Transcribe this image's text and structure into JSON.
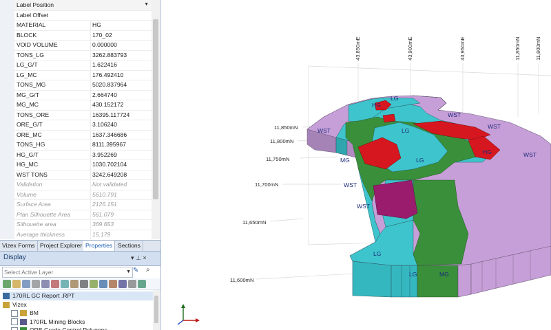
{
  "properties": {
    "rows": [
      {
        "key": "Label Position",
        "value": "",
        "has_dropdown": true,
        "selected": true
      },
      {
        "key": "Label Offset",
        "value": ""
      },
      {
        "key": "MATERIAL",
        "value": "HG"
      },
      {
        "key": "BLOCK",
        "value": "170_02"
      },
      {
        "key": "VOID VOLUME",
        "value": "0.000000"
      },
      {
        "key": "TONS_LG",
        "value": "3262.883793"
      },
      {
        "key": "LG_G/T",
        "value": "1.622416"
      },
      {
        "key": "LG_MC",
        "value": "176.492410"
      },
      {
        "key": "TONS_MG",
        "value": "5020.837964"
      },
      {
        "key": "MG_G/T",
        "value": "2.664740"
      },
      {
        "key": "MG_MC",
        "value": "430.152172"
      },
      {
        "key": "TONS_ORE",
        "value": "16395.117724"
      },
      {
        "key": "ORE_G/T",
        "value": "3.106240"
      },
      {
        "key": "ORE_MC",
        "value": "1637.346686"
      },
      {
        "key": "TONS_HG",
        "value": "8111.395967"
      },
      {
        "key": "HG_G/T",
        "value": "3.952269"
      },
      {
        "key": "HG_MC",
        "value": "1030.702104"
      },
      {
        "key": "WST TONS",
        "value": "3242.649208"
      },
      {
        "key": "Validation",
        "value": "Not validated",
        "disabled": true
      },
      {
        "key": "Volume",
        "value": "5610.791",
        "disabled": true
      },
      {
        "key": "Surface Area",
        "value": "2126.151",
        "disabled": true
      },
      {
        "key": "Plan Silhouette Area",
        "value": "561.079",
        "disabled": true
      },
      {
        "key": "Silhouette area",
        "value": "369.653",
        "disabled": true
      },
      {
        "key": "Average thickness",
        "value": "15.179",
        "disabled": true
      }
    ]
  },
  "tabs": [
    {
      "label": "Vizex Forms",
      "active": false
    },
    {
      "label": "Project Explorer",
      "active": false
    },
    {
      "label": "Properties",
      "active": true
    },
    {
      "label": "Sections",
      "active": false
    }
  ],
  "display": {
    "title": "Display",
    "pin_glyph": "▾ ⊥ ×",
    "layer_placeholder": "Select Active Layer",
    "tree": [
      {
        "label": "170RL GC Report .RPT",
        "indent": 0,
        "checkbox": false,
        "selected": true,
        "icon": "report-icon"
      },
      {
        "label": "Vizex",
        "indent": 0,
        "checkbox": false,
        "icon": "folder-icon"
      },
      {
        "label": "BM",
        "indent": 1,
        "checkbox": true,
        "icon": "block-model-icon"
      },
      {
        "label": "170RL Mining Blocks",
        "indent": 1,
        "checkbox": true,
        "icon": "mining-blocks-icon"
      },
      {
        "label": "ORE Grade Control Polygons",
        "indent": 1,
        "checkbox": true,
        "icon": "polygon-icon"
      }
    ]
  },
  "viewport": {
    "easting_labels": [
      "43,850mE",
      "43,900mE",
      "43,950mE",
      "11,850mN",
      "11,800mN"
    ],
    "northing_labels": [
      "11,850mN",
      "11,800mN",
      "11,750mN",
      "11,700mN",
      "11,650mN",
      "11,600mN"
    ],
    "zone_labels": [
      {
        "text": "LG"
      },
      {
        "text": "HG"
      },
      {
        "text": "WST"
      },
      {
        "text": "WST"
      },
      {
        "text": "LG"
      },
      {
        "text": "WST"
      },
      {
        "text": "HG"
      },
      {
        "text": "WST"
      },
      {
        "text": "MG"
      },
      {
        "text": "LG"
      },
      {
        "text": "WST"
      },
      {
        "text": "WST"
      },
      {
        "text": "LG"
      },
      {
        "text": "LG"
      },
      {
        "text": "MG"
      }
    ]
  },
  "colors": {
    "wst": "#c79fd8",
    "lg": "#3ec4cc",
    "mg": "#3a8f3a",
    "hg": "#d61720",
    "hg_dark": "#9a1c6c",
    "panel_accent": "#1f5fb8"
  }
}
